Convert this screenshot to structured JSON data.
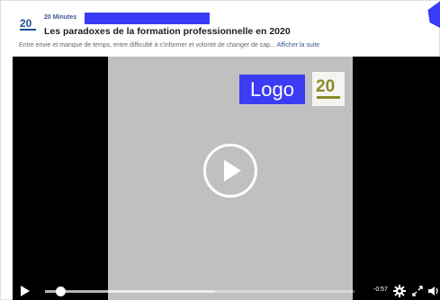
{
  "post": {
    "page_name": "20 Minutes",
    "title": "Les paradoxes de la formation professionnelle en 2020",
    "description": "Entre envie et manque de temps, entre difficulté à s'informer et volonté de changer de cap...",
    "see_more": "Afficher la suite"
  },
  "video": {
    "overlay_logo_text": "Logo",
    "time_remaining": "-0:57",
    "progress_played": 0.05,
    "progress_buffered": 0.55
  },
  "colors": {
    "link": "#385898",
    "redaction": "#3a3cf5",
    "logo_box": "#3c3cf5",
    "brand_olive": "#8a8a2a"
  },
  "icons": {
    "play": "play-icon",
    "settings": "gear-icon",
    "fullscreen": "fullscreen-icon",
    "volume": "volume-icon"
  }
}
